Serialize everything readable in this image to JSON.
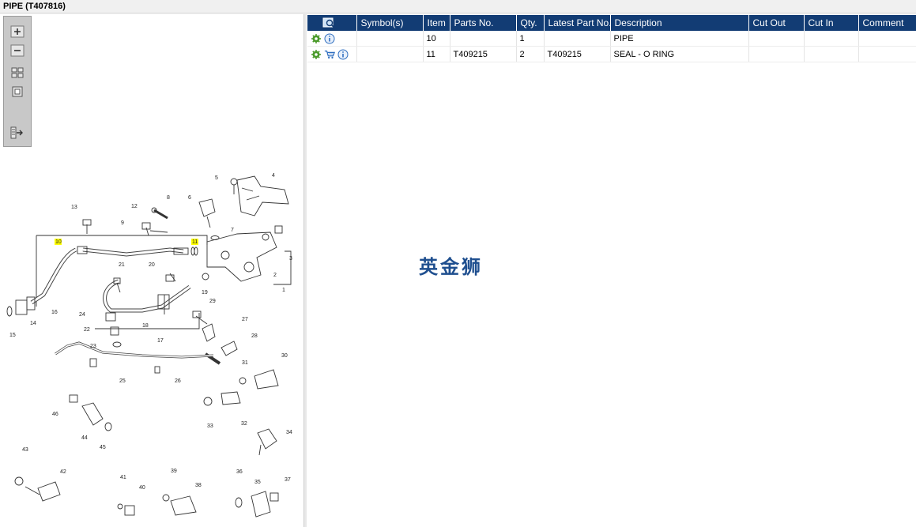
{
  "window": {
    "title": "PIPE (T407816)"
  },
  "toolbar": {
    "buttons": [
      {
        "name": "zoom-in",
        "icon": "zoom-in-icon"
      },
      {
        "name": "zoom-out",
        "icon": "zoom-out-icon"
      },
      {
        "name": "fit-all",
        "icon": "fit-all-icon"
      },
      {
        "name": "actual-size",
        "icon": "actual-size-icon"
      },
      {
        "name": "export",
        "icon": "export-panel-icon"
      }
    ]
  },
  "diagram": {
    "callouts": [
      "1",
      "2",
      "3",
      "4",
      "5",
      "6",
      "7",
      "8",
      "9",
      "10",
      "11",
      "12",
      "13",
      "14",
      "15",
      "16",
      "17",
      "18",
      "19",
      "20",
      "21",
      "22",
      "23",
      "24",
      "25",
      "26",
      "27",
      "28",
      "29",
      "30",
      "31",
      "32",
      "33",
      "34",
      "35",
      "36",
      "37",
      "38",
      "39",
      "40",
      "41",
      "42",
      "43",
      "44",
      "45",
      "46"
    ],
    "highlighted": [
      "10",
      "11"
    ],
    "highlight_color": "#ffff00"
  },
  "table": {
    "header_icon": "search-catalog-icon",
    "columns": [
      "Symbol(s)",
      "Item",
      "Parts No.",
      "Qty.",
      "Latest Part No.",
      "Description",
      "Cut Out",
      "Cut In",
      "Comment"
    ],
    "rows": [
      {
        "icons": [
          "gear-icon",
          "info-icon"
        ],
        "symbols": "",
        "item": "10",
        "part_no": "",
        "qty": "1",
        "latest": "",
        "description": "PIPE",
        "cut_out": "",
        "cut_in": "",
        "comment": ""
      },
      {
        "icons": [
          "gear-icon",
          "cart-icon",
          "info-icon"
        ],
        "symbols": "",
        "item": "11",
        "part_no": "T409215",
        "qty": "2",
        "latest": "T409215",
        "description": "SEAL - O RING",
        "cut_out": "",
        "cut_in": "",
        "comment": ""
      }
    ]
  },
  "watermark": "英金狮",
  "colors": {
    "header_bg": "#123c74",
    "accent_green": "#4a9a2a",
    "info_blue": "#2f6fc0",
    "watermark": "#1f4f8f"
  }
}
